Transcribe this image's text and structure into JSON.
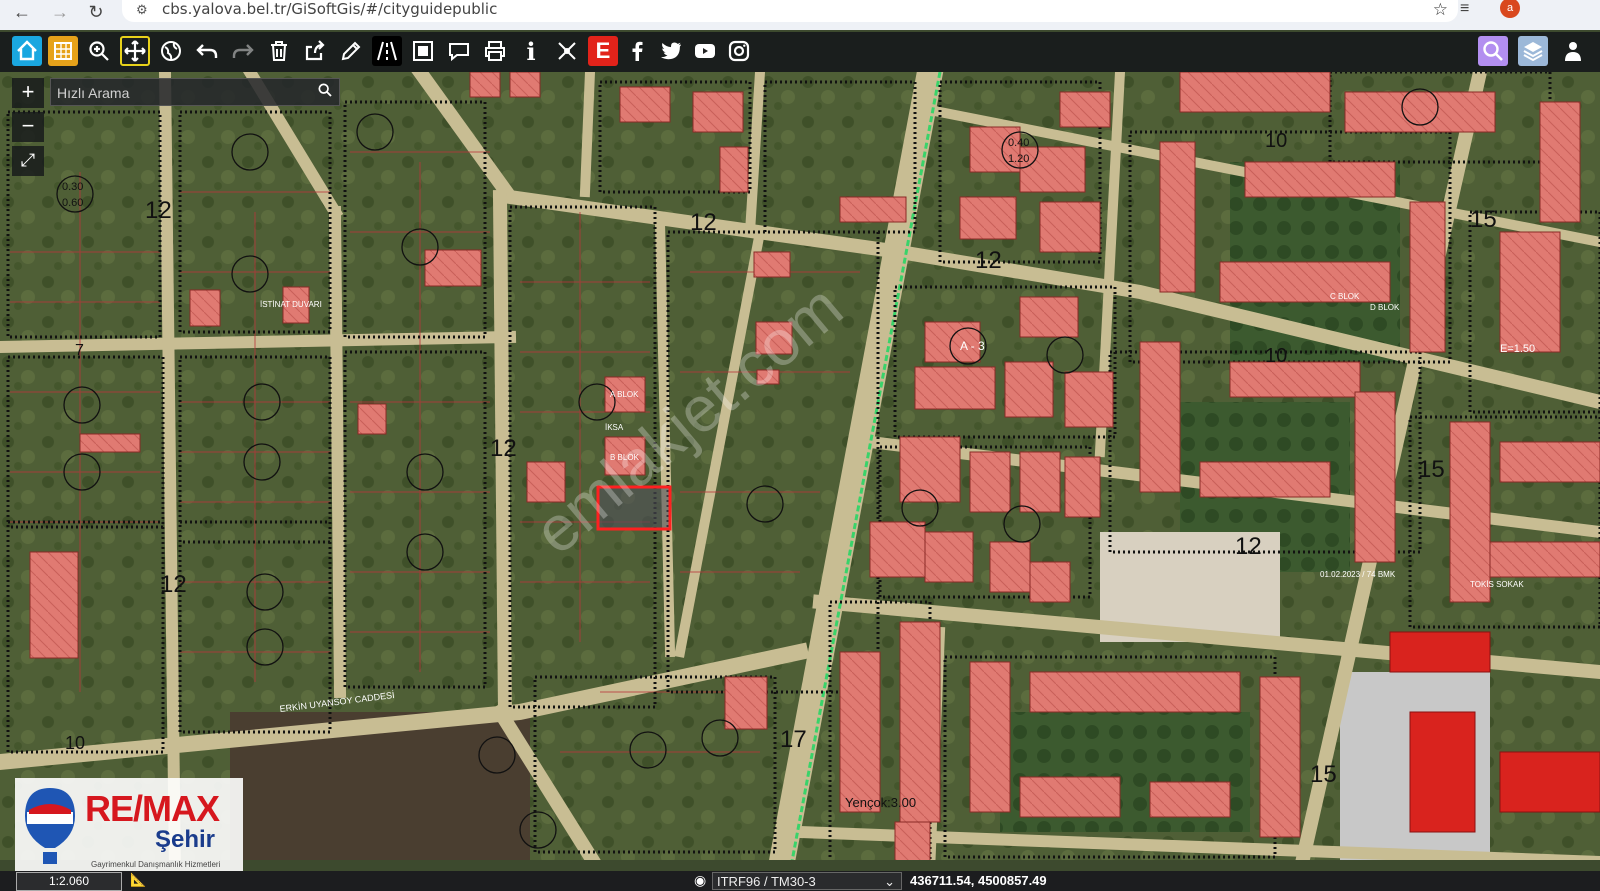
{
  "browser": {
    "url": "cbs.yalova.bel.tr/GiSoftGis/#/cityguidepublic",
    "profile_initial": "a"
  },
  "toolbar": {
    "tools": [
      "home-icon",
      "layers-grid-icon",
      "zoom-in-icon",
      "pan-move-icon",
      "globe-icon",
      "undo-icon",
      "redo-icon",
      "trash-icon",
      "share-icon",
      "pencil-icon",
      "road-icon",
      "frame-icon",
      "comment-icon",
      "print-icon",
      "info-icon",
      "measure-icon",
      "e-logo-icon",
      "facebook-icon",
      "twitter-icon",
      "youtube-icon",
      "instagram-icon"
    ],
    "right_tools": [
      "search-icon",
      "layers-icon",
      "user-icon"
    ],
    "e_label": "E",
    "info_label": "i"
  },
  "controls": {
    "zoom_in": "+",
    "zoom_out": "−",
    "fullscreen": "⤢"
  },
  "search": {
    "placeholder": "Hızlı Arama"
  },
  "status": {
    "scale": "1:2.060",
    "crs": "ITRF96 / TM30-3",
    "coordinates": "436711.54, 4500857.49"
  },
  "logo": {
    "brand": "RE/MAX",
    "city": "Şehir",
    "tagline": "Gayrimenkul Danışmanlık Hizmetleri"
  },
  "watermark": "emlakjet.com",
  "map_labels": {
    "road_12_a": "12",
    "road_12_b": "12",
    "road_12_c": "12",
    "road_12_d": "12",
    "road_12_e": "12",
    "road_12_f": "12",
    "road_10_a": "10",
    "road_10_b": "10",
    "road_10_c": "10",
    "road_7_a": "7",
    "road_17": "17",
    "road_15_a": "15",
    "road_15_b": "15",
    "road_15_c": "15",
    "street_erkin": "ERKİN UYANSOY CADDESİ",
    "label_ablok": "A BLOK",
    "label_bblok": "B BLOK",
    "label_iksa": "İKSA",
    "label_istinat": "İSTİNAT DUVARI",
    "label_cblok": "C BLOK",
    "label_dblok": "D BLOK",
    "label_yencok": "Yençok:3.00",
    "label_emsal": "E=1.50",
    "label_a3": "A - 3",
    "label_date": "01.02.2023 / 74 BMK",
    "label_tokis": "TOKİS SOKAK",
    "zone_030": "0.30",
    "zone_060": "0.60",
    "zone_040": "0.40",
    "zone_120": "1.20"
  }
}
